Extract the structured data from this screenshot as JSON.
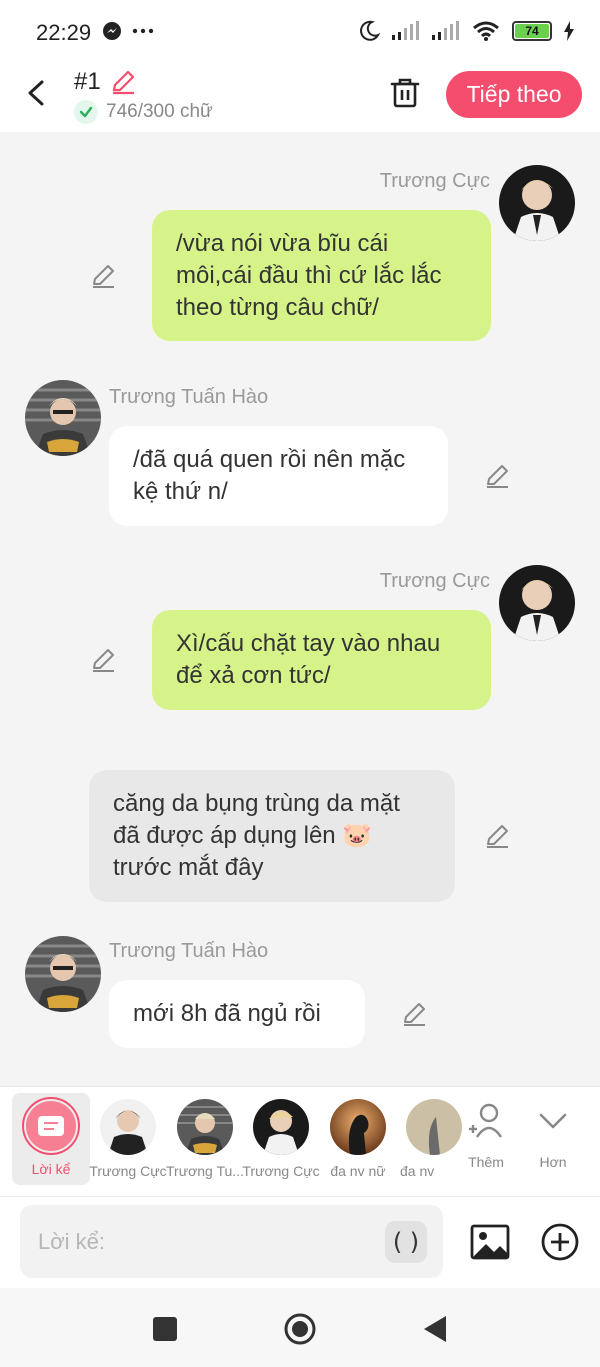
{
  "status_bar": {
    "time": "22:29",
    "battery": "74"
  },
  "header": {
    "title": "#1",
    "word_count": "746/300 chữ",
    "next_label": "Tiếp theo"
  },
  "messages": [
    {
      "sender": "Trương Cực",
      "side": "right",
      "style": "green",
      "text": "/vừa nói vừa bĩu cái môi,cái đầu thì cứ lắc lắc theo từng câu chữ/"
    },
    {
      "sender": "Trương Tuấn Hào",
      "side": "left",
      "style": "white",
      "text": "/đã quá quen rồi nên mặc kệ thứ n/"
    },
    {
      "sender": "Trương Cực",
      "side": "right",
      "style": "green",
      "text": "Xì/cấu chặt tay vào nhau để xả cơn tức/"
    },
    {
      "sender": "",
      "side": "narration",
      "style": "gray",
      "text": "căng da bụng trùng da mặt đã được áp dụng lên 🐷 trước mắt đây"
    },
    {
      "sender": "Trương Tuấn Hào",
      "side": "left",
      "style": "white",
      "text": "mới 8h đã ngủ rồi"
    }
  ],
  "characters": {
    "narration_label": "Lời kể",
    "items": [
      "Trương Cực",
      "Trương Tu...",
      "Trương Cực",
      "đa nv nữ",
      "đa nv"
    ],
    "more_label": "Thêm",
    "expand_label": "Hơn"
  },
  "input": {
    "placeholder": "Lời kể:",
    "paren_label": "( )"
  },
  "colors": {
    "accent": "#f44d6e",
    "green_bubble": "#d6f38a",
    "background": "#f4f4f4"
  }
}
